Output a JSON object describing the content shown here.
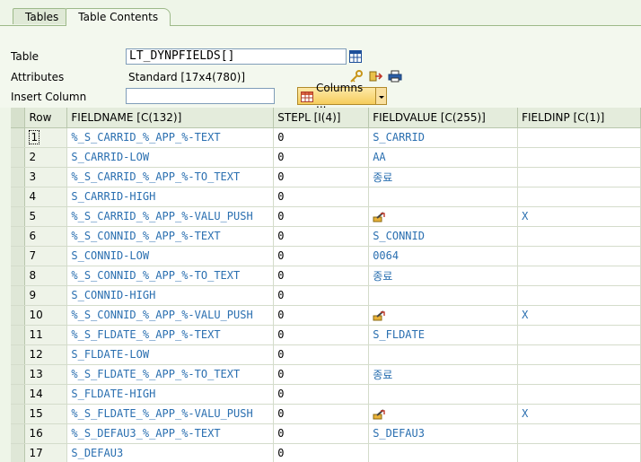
{
  "tabs": [
    {
      "label": "Tables"
    },
    {
      "label": "Table Contents"
    }
  ],
  "form": {
    "table_label": "Table",
    "table_value": "LT_DYNPFIELDS[]",
    "attributes_label": "Attributes",
    "attributes_value": "Standard [17x4(780)]",
    "insert_label": "Insert Column",
    "insert_value": "",
    "columns_button": "Columns ..."
  },
  "grid": {
    "headers": [
      "Row",
      "FIELDNAME [C(132)]",
      "STEPL [I(4)]",
      "FIELDVALUE [C(255)]",
      "FIELDINP [C(1)]"
    ],
    "rows": [
      {
        "row": "1",
        "fieldname": "%_S_CARRID_%_APP_%-TEXT",
        "stepl": "0",
        "fieldvalue": "S_CARRID",
        "fieldinp": ""
      },
      {
        "row": "2",
        "fieldname": "S_CARRID-LOW",
        "stepl": "0",
        "fieldvalue": "AA",
        "fieldinp": ""
      },
      {
        "row": "3",
        "fieldname": "%_S_CARRID_%_APP_%-TO_TEXT",
        "stepl": "0",
        "fieldvalue": "종료",
        "fieldinp": ""
      },
      {
        "row": "4",
        "fieldname": "S_CARRID-HIGH",
        "stepl": "0",
        "fieldvalue": "",
        "fieldinp": ""
      },
      {
        "row": "5",
        "fieldname": "%_S_CARRID_%_APP_%-VALU_PUSH",
        "stepl": "0",
        "fieldvalue": "[icon]",
        "fieldinp": "X"
      },
      {
        "row": "6",
        "fieldname": "%_S_CONNID_%_APP_%-TEXT",
        "stepl": "0",
        "fieldvalue": "S_CONNID",
        "fieldinp": ""
      },
      {
        "row": "7",
        "fieldname": "S_CONNID-LOW",
        "stepl": "0",
        "fieldvalue": "0064",
        "fieldinp": ""
      },
      {
        "row": "8",
        "fieldname": "%_S_CONNID_%_APP_%-TO_TEXT",
        "stepl": "0",
        "fieldvalue": "종료",
        "fieldinp": ""
      },
      {
        "row": "9",
        "fieldname": "S_CONNID-HIGH",
        "stepl": "0",
        "fieldvalue": "",
        "fieldinp": ""
      },
      {
        "row": "10",
        "fieldname": "%_S_CONNID_%_APP_%-VALU_PUSH",
        "stepl": "0",
        "fieldvalue": "[icon]",
        "fieldinp": "X"
      },
      {
        "row": "11",
        "fieldname": "%_S_FLDATE_%_APP_%-TEXT",
        "stepl": "0",
        "fieldvalue": "S_FLDATE",
        "fieldinp": ""
      },
      {
        "row": "12",
        "fieldname": "S_FLDATE-LOW",
        "stepl": "0",
        "fieldvalue": "",
        "fieldinp": ""
      },
      {
        "row": "13",
        "fieldname": "%_S_FLDATE_%_APP_%-TO_TEXT",
        "stepl": "0",
        "fieldvalue": "종료",
        "fieldinp": ""
      },
      {
        "row": "14",
        "fieldname": "S_FLDATE-HIGH",
        "stepl": "0",
        "fieldvalue": "",
        "fieldinp": ""
      },
      {
        "row": "15",
        "fieldname": "%_S_FLDATE_%_APP_%-VALU_PUSH",
        "stepl": "0",
        "fieldvalue": "[icon]",
        "fieldinp": "X"
      },
      {
        "row": "16",
        "fieldname": "%_S_DEFAU3_%_APP_%-TEXT",
        "stepl": "0",
        "fieldvalue": "S_DEFAU3",
        "fieldinp": ""
      },
      {
        "row": "17",
        "fieldname": "S_DEFAU3",
        "stepl": "0",
        "fieldvalue": "",
        "fieldinp": ""
      }
    ]
  },
  "icons": {
    "table_browse": "table-grid-icon",
    "push_value": "pencil-arrow-icon"
  }
}
